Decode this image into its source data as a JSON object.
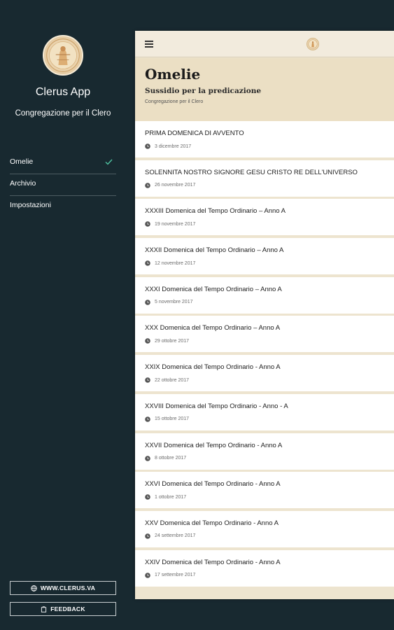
{
  "sidebar": {
    "app_name": "Clerus App",
    "subtitle": "Congregazione per il Clero",
    "menu": [
      {
        "label": "Omelie",
        "selected": true
      },
      {
        "label": "Archivio",
        "selected": false
      },
      {
        "label": "Impostazioni",
        "selected": false
      }
    ],
    "website_button": "WWW.CLERUS.VA",
    "feedback_button": "FEEDBACK",
    "accent_color": "#4fc3a1"
  },
  "toolbar": {
    "menu_icon": "hamburger-menu-icon",
    "logo_icon": "clerus-seal-icon"
  },
  "header": {
    "title": "Omelie",
    "subtitle": "Sussidio per la predicazione",
    "org": "Congregazione per il Clero"
  },
  "homilies": [
    {
      "title": "PRIMA DOMENICA DI AVVENTO",
      "date": "3 dicembre 2017"
    },
    {
      "title": "SOLENNITA NOSTRO SIGNORE GESU CRISTO RE DELL'UNIVERSO",
      "date": "26 novembre 2017"
    },
    {
      "title": "XXXIII Domenica del Tempo Ordinario – Anno A",
      "date": "19 novembre 2017"
    },
    {
      "title": "XXXII Domenica del Tempo Ordinario – Anno A",
      "date": "12 novembre 2017"
    },
    {
      "title": "XXXI Domenica del Tempo Ordinario – Anno A",
      "date": "5 novembre 2017"
    },
    {
      "title": "XXX Domenica del Tempo Ordinario – Anno A",
      "date": "29 ottobre 2017"
    },
    {
      "title": "XXIX Domenica del Tempo Ordinario - Anno A",
      "date": "22 ottobre 2017"
    },
    {
      "title": "XXVIII Domenica del Tempo Ordinario - Anno - A",
      "date": "15 ottobre 2017"
    },
    {
      "title": "XXVII Domenica del Tempo Ordinario - Anno A",
      "date": "8 ottobre 2017"
    },
    {
      "title": "XXVI Domenica del Tempo Ordinario - Anno A",
      "date": "1 ottobre 2017"
    },
    {
      "title": "XXV Domenica del Tempo Ordinario - Anno A",
      "date": "24 settembre 2017"
    },
    {
      "title": "XXIV Domenica del Tempo Ordinario - Anno A",
      "date": "17 settembre 2017"
    }
  ],
  "colors": {
    "sidebar_bg": "#182930",
    "header_bg": "#ebdfc4",
    "list_separator": "#ede4cf"
  }
}
